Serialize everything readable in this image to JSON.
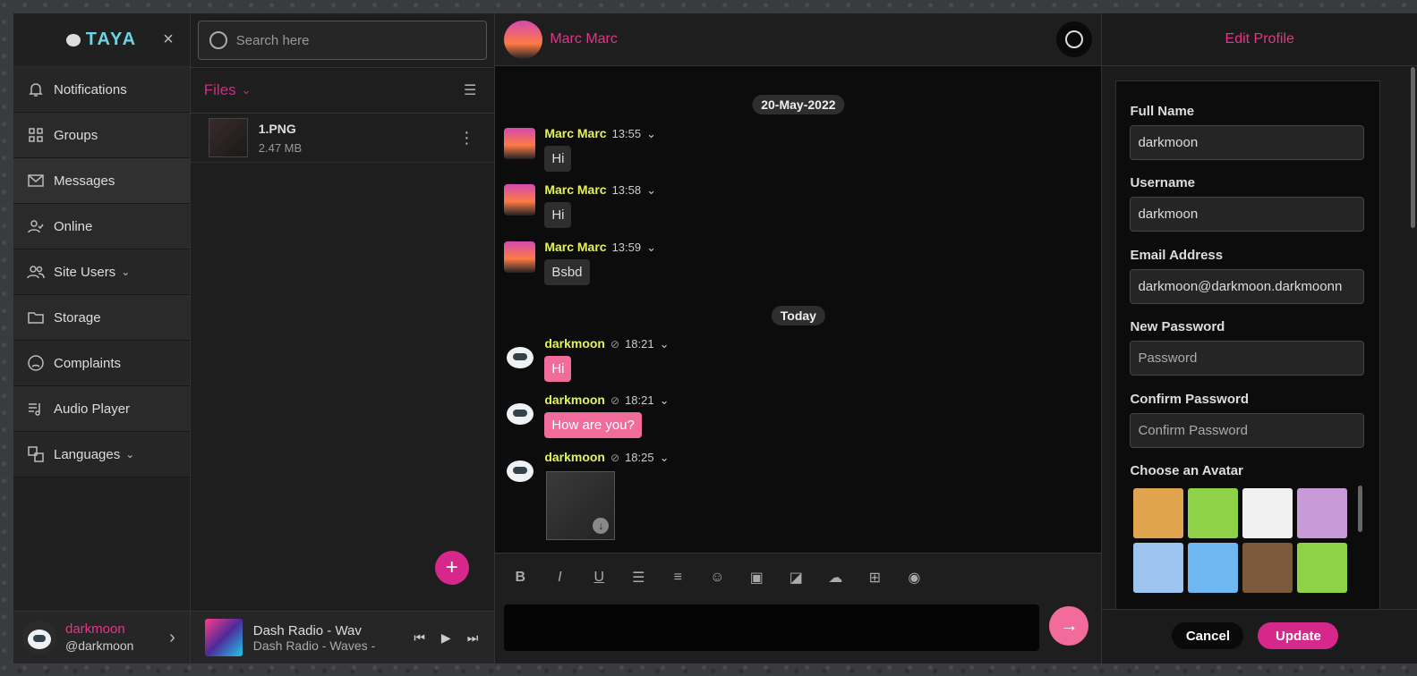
{
  "brand": {
    "logo_text": "TAYA"
  },
  "sidebar": {
    "items": [
      {
        "label": "Notifications",
        "icon": "bell-icon"
      },
      {
        "label": "Groups",
        "icon": "grid-icon"
      },
      {
        "label": "Messages",
        "icon": "mail-icon"
      },
      {
        "label": "Online",
        "icon": "user-check-icon"
      },
      {
        "label": "Site Users",
        "icon": "users-icon",
        "has_chevron": true
      },
      {
        "label": "Storage",
        "icon": "folder-icon"
      },
      {
        "label": "Complaints",
        "icon": "sad-face-icon"
      },
      {
        "label": "Audio Player",
        "icon": "playlist-icon"
      },
      {
        "label": "Languages",
        "icon": "translate-icon",
        "has_chevron": true
      }
    ],
    "user": {
      "name": "darkmoon",
      "handle": "@darkmoon"
    }
  },
  "search": {
    "placeholder": "Search here"
  },
  "files": {
    "title": "Files",
    "items": [
      {
        "name": "1.PNG",
        "size": "2.47 MB"
      }
    ]
  },
  "player": {
    "title": "Dash Radio - Wav",
    "subtitle": "Dash Radio - Waves -"
  },
  "chat": {
    "contact": "Marc Marc",
    "days": [
      "20-May-2022",
      "Today"
    ],
    "messages": [
      {
        "sender": "Marc Marc",
        "time": "13:55",
        "text": "Hi",
        "own": false
      },
      {
        "sender": "Marc Marc",
        "time": "13:58",
        "text": "Hi",
        "own": false
      },
      {
        "sender": "Marc Marc",
        "time": "13:59",
        "text": "Bsbd",
        "own": false
      },
      {
        "sender": "darkmoon",
        "time": "18:21",
        "text": "Hi",
        "own": true
      },
      {
        "sender": "darkmoon",
        "time": "18:21",
        "text": "How are you?",
        "own": true
      },
      {
        "sender": "darkmoon",
        "time": "18:25",
        "text": "",
        "own": true,
        "image": true
      }
    ],
    "toolbar": [
      "B",
      "I",
      "U",
      "bullet-list-icon",
      "numbered-list-icon",
      "emoji-icon",
      "video-icon",
      "sticker-icon",
      "upload-icon",
      "folder-add-icon",
      "microphone-icon"
    ]
  },
  "profile": {
    "title": "Edit Profile",
    "fields": [
      {
        "label": "Full Name",
        "value": "darkmoon",
        "placeholder": ""
      },
      {
        "label": "Username",
        "value": "darkmoon",
        "placeholder": ""
      },
      {
        "label": "Email Address",
        "value": "darkmoon@darkmoon.darkmoonn",
        "placeholder": ""
      },
      {
        "label": "New Password",
        "value": "",
        "placeholder": "Password"
      },
      {
        "label": "Confirm Password",
        "value": "",
        "placeholder": "Confirm Password"
      }
    ],
    "avatar_label": "Choose an Avatar",
    "cancel": "Cancel",
    "update": "Update"
  },
  "colors": {
    "accent": "#d6278a",
    "bubble_out": "#f26c9b",
    "sender": "#e6f25a"
  }
}
